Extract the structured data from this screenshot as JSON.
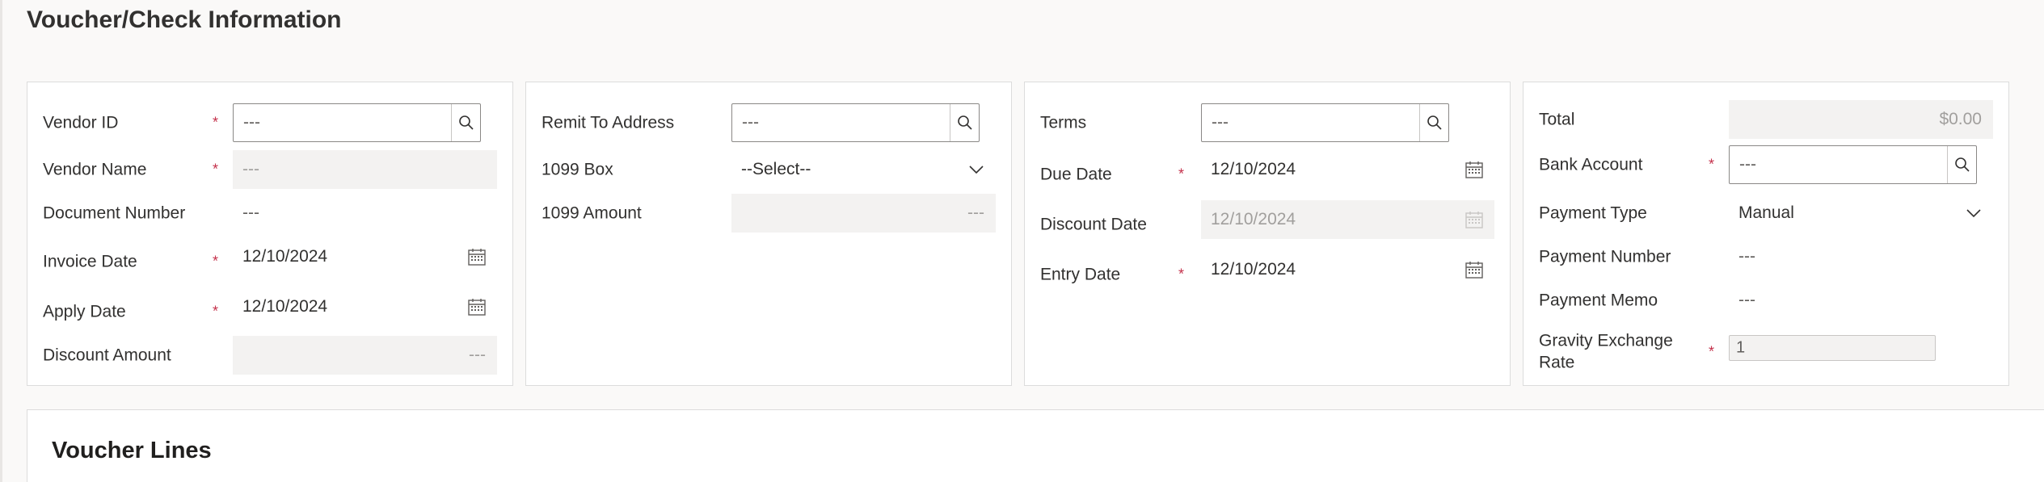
{
  "page": {
    "title": "Voucher/Check Information"
  },
  "vendor_card": {
    "vendor_id": {
      "label": "Vendor ID",
      "value": "---",
      "required": "*"
    },
    "vendor_name": {
      "label": "Vendor Name",
      "value": "---",
      "required": "*"
    },
    "document_number": {
      "label": "Document Number",
      "value": "---"
    },
    "invoice_date": {
      "label": "Invoice Date",
      "value": "12/10/2024",
      "required": "*"
    },
    "apply_date": {
      "label": "Apply Date",
      "value": "12/10/2024",
      "required": "*"
    },
    "discount_amount": {
      "label": "Discount Amount",
      "value": "---"
    }
  },
  "remit_card": {
    "remit_to_address": {
      "label": "Remit To Address",
      "value": "---"
    },
    "box_1099": {
      "label": "1099 Box",
      "value": "--Select--"
    },
    "amount_1099": {
      "label": "1099 Amount",
      "value": "---"
    }
  },
  "terms_card": {
    "terms": {
      "label": "Terms",
      "value": "---"
    },
    "due_date": {
      "label": "Due Date",
      "value": "12/10/2024",
      "required": "*"
    },
    "discount_date": {
      "label": "Discount Date",
      "value": "12/10/2024"
    },
    "entry_date": {
      "label": "Entry Date",
      "value": "12/10/2024",
      "required": "*"
    }
  },
  "payment_card": {
    "total": {
      "label": "Total",
      "value": "$0.00"
    },
    "bank_account": {
      "label": "Bank Account",
      "value": "---",
      "required": "*"
    },
    "payment_type": {
      "label": "Payment Type",
      "value": "Manual"
    },
    "payment_number": {
      "label": "Payment Number",
      "value": "---"
    },
    "payment_memo": {
      "label": "Payment Memo",
      "value": "---"
    },
    "exchange_rate": {
      "label": "Gravity Exchange Rate",
      "value": "1",
      "required": "*"
    }
  },
  "voucher_lines": {
    "title": "Voucher Lines"
  },
  "icons": {
    "search": "search-icon",
    "calendar": "calendar-icon",
    "chevron": "chevron-down-icon"
  },
  "colors": {
    "required": "#c4314b",
    "readonly_bg": "#f3f2f1",
    "border": "#8a8886"
  }
}
